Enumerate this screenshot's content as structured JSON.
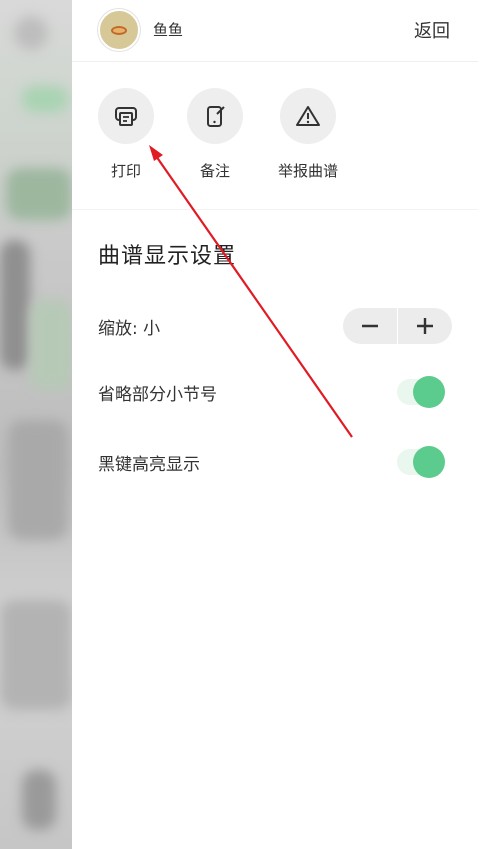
{
  "header": {
    "username": "鱼鱼",
    "back_label": "返回"
  },
  "actions": [
    {
      "label": "打印",
      "icon": "printer-icon"
    },
    {
      "label": "备注",
      "icon": "note-phone-icon"
    },
    {
      "label": "举报曲谱",
      "icon": "warning-icon"
    }
  ],
  "settings": {
    "title": "曲谱显示设置",
    "zoom_label": "缩放: 小",
    "zoom_minus": "−",
    "zoom_plus": "+",
    "omit_measure_label": "省略部分小节号",
    "omit_measure_on": true,
    "black_key_label": "黑键高亮显示",
    "black_key_on": true
  },
  "colors": {
    "accent_green": "#5ccb8e",
    "annotation_arrow": "#e01b24"
  }
}
